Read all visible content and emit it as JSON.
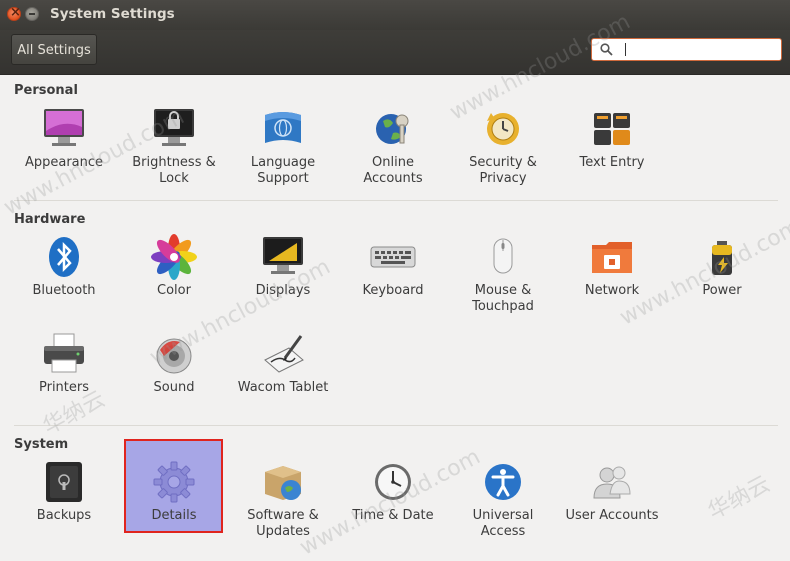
{
  "window": {
    "title": "System Settings"
  },
  "toolbar": {
    "all_settings_label": "All Settings",
    "search_value": ""
  },
  "sections": {
    "personal": {
      "title": "Personal",
      "items": [
        {
          "label": "Appearance",
          "icon": "appearance-icon"
        },
        {
          "label": "Brightness & Lock",
          "icon": "brightness-lock-icon"
        },
        {
          "label": "Language Support",
          "icon": "language-support-icon"
        },
        {
          "label": "Online Accounts",
          "icon": "online-accounts-icon"
        },
        {
          "label": "Security & Privacy",
          "icon": "security-privacy-icon"
        },
        {
          "label": "Text Entry",
          "icon": "text-entry-icon"
        }
      ]
    },
    "hardware": {
      "title": "Hardware",
      "items": [
        {
          "label": "Bluetooth",
          "icon": "bluetooth-icon"
        },
        {
          "label": "Color",
          "icon": "color-icon"
        },
        {
          "label": "Displays",
          "icon": "displays-icon"
        },
        {
          "label": "Keyboard",
          "icon": "keyboard-icon"
        },
        {
          "label": "Mouse & Touchpad",
          "icon": "mouse-touchpad-icon"
        },
        {
          "label": "Network",
          "icon": "network-icon"
        },
        {
          "label": "Power",
          "icon": "power-icon"
        },
        {
          "label": "Printers",
          "icon": "printers-icon"
        },
        {
          "label": "Sound",
          "icon": "sound-icon"
        },
        {
          "label": "Wacom Tablet",
          "icon": "wacom-tablet-icon"
        }
      ]
    },
    "system": {
      "title": "System",
      "items": [
        {
          "label": "Backups",
          "icon": "backups-icon"
        },
        {
          "label": "Details",
          "icon": "details-icon",
          "selected": true
        },
        {
          "label": "Software & Updates",
          "icon": "software-updates-icon"
        },
        {
          "label": "Time & Date",
          "icon": "time-date-icon"
        },
        {
          "label": "Universal Access",
          "icon": "universal-access-icon"
        },
        {
          "label": "User Accounts",
          "icon": "user-accounts-icon"
        }
      ]
    }
  },
  "colors": {
    "titlebar": "#3b3a36",
    "background": "#f2f1f0",
    "selection": "#a7a6e6",
    "highlight_border": "#e0241e",
    "search_focus": "#d06a3c"
  },
  "watermarks": [
    "www.hncloud.com",
    "华纳云"
  ]
}
